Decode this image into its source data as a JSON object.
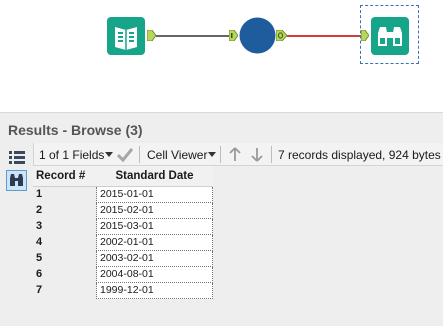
{
  "results": {
    "title": "Results - Browse (3)",
    "toolbar": {
      "fields_label": "1 of 1 Fields",
      "viewer_label": "Cell Viewer",
      "status": "7 records displayed, 924 bytes"
    },
    "columns": [
      "Record #",
      "Standard Date"
    ],
    "rows": [
      {
        "record": "1",
        "date": "2015-01-01"
      },
      {
        "record": "2",
        "date": "2015-02-01"
      },
      {
        "record": "3",
        "date": "2015-03-01"
      },
      {
        "record": "4",
        "date": "2002-01-01"
      },
      {
        "record": "5",
        "date": "2003-02-01"
      },
      {
        "record": "6",
        "date": "2004-08-01"
      },
      {
        "record": "7",
        "date": "1999-12-01"
      }
    ]
  },
  "colors": {
    "tool_green": "#17a589",
    "formula_blue": "#1f5c9e",
    "connector_gray": "#666666",
    "connector_red": "#d43b3b",
    "anchor_green": "#b6d75a"
  },
  "icons": {
    "input_tool": "book-icon",
    "formula_tool": "circle-node-icon",
    "browse_tool": "binoculars-icon"
  }
}
